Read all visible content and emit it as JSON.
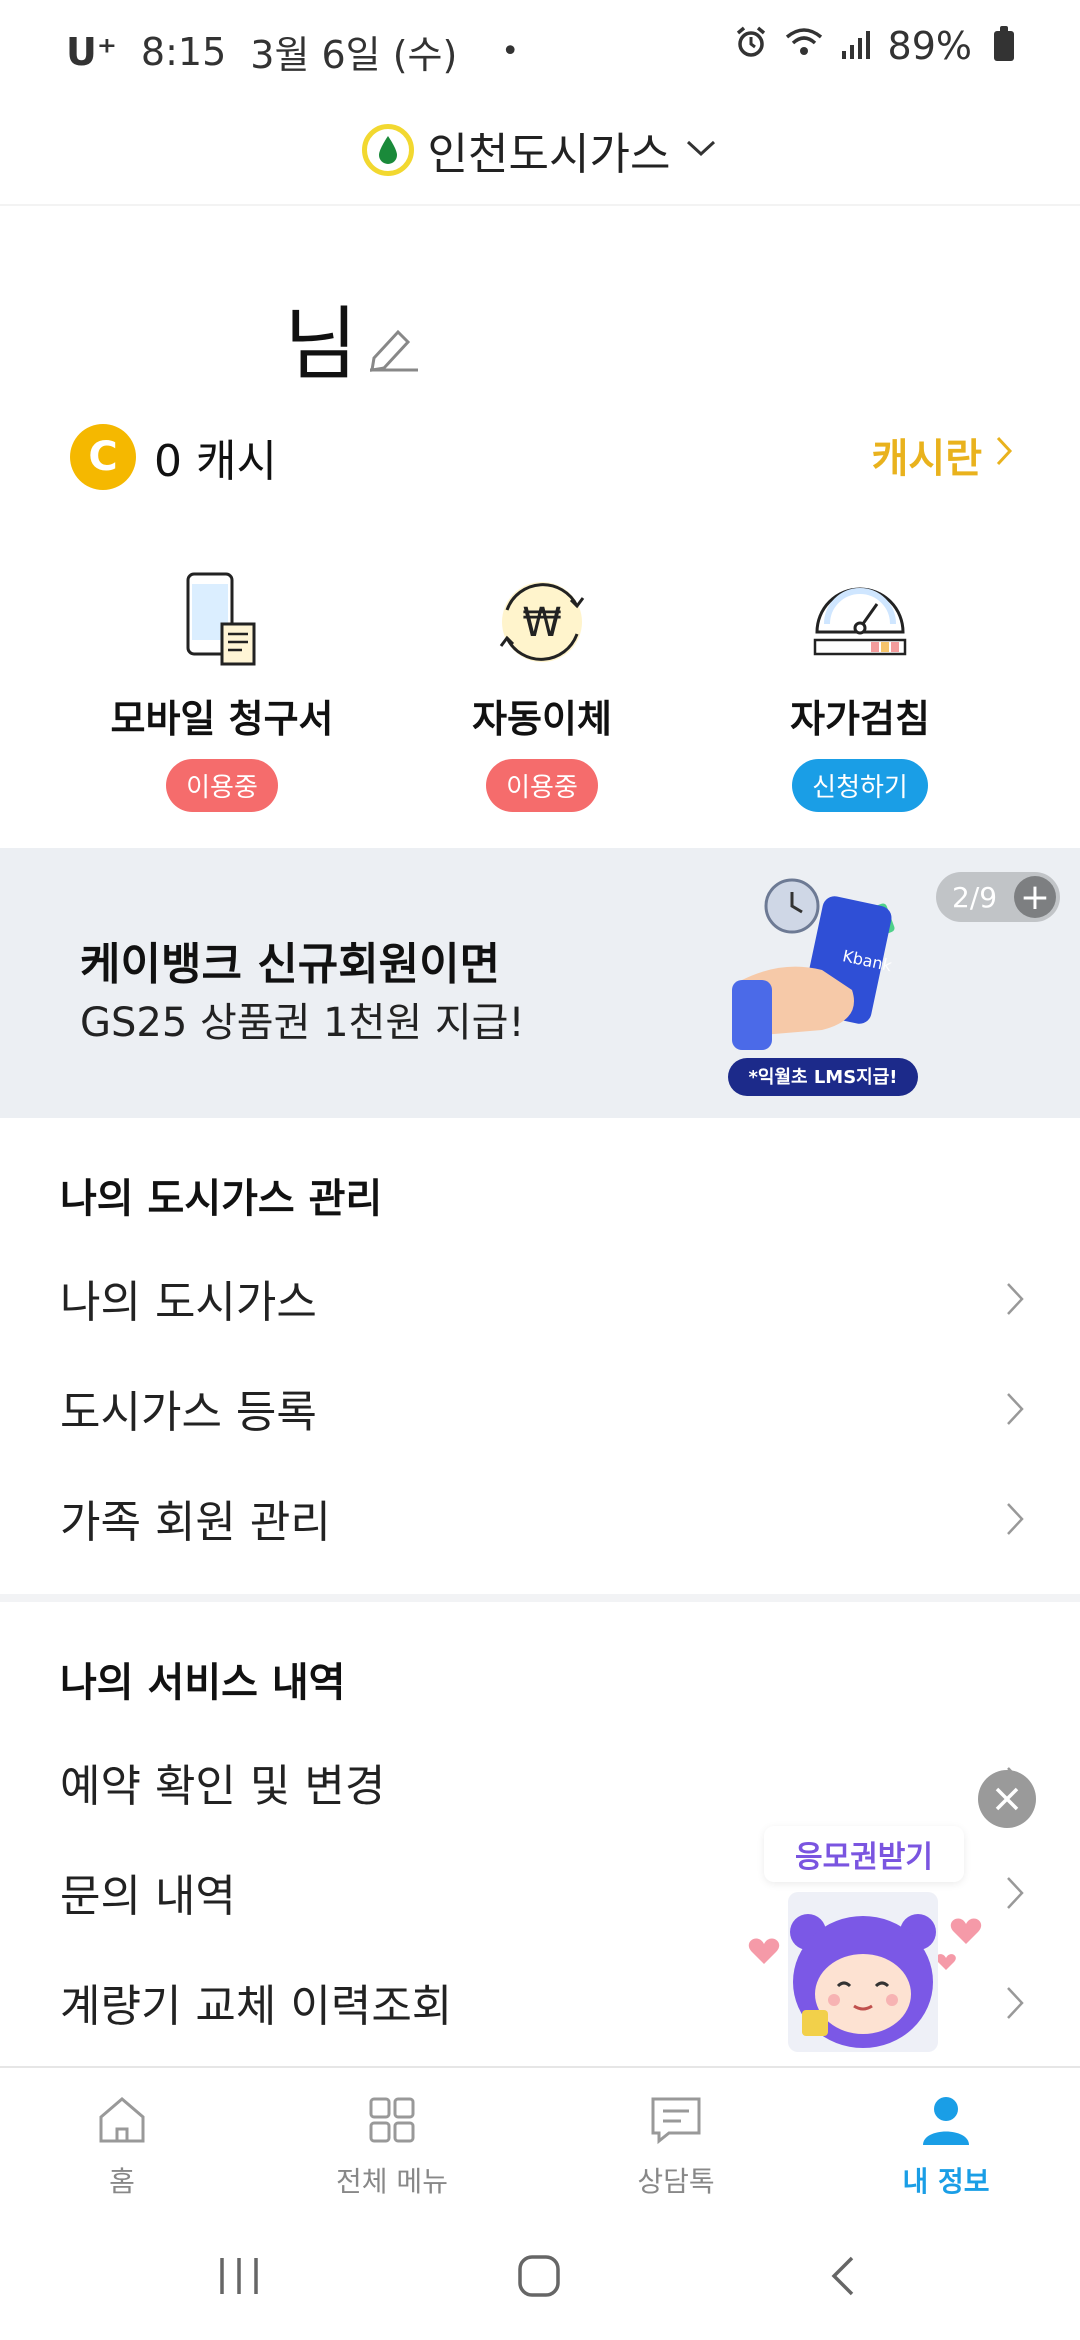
{
  "status_bar": {
    "carrier": "U⁺",
    "time": "8:15",
    "date": "3월 6일 (수)",
    "dot": "•",
    "battery": "89%"
  },
  "header": {
    "title": "인천도시가스",
    "logo_icon": "gas-drop-icon",
    "dropdown_icon": "chevron-down-icon"
  },
  "profile": {
    "name_suffix": "님",
    "edit_icon": "pencil-icon"
  },
  "cash": {
    "coin_letter": "C",
    "value": "0 캐시",
    "link_label": "캐시란"
  },
  "services": [
    {
      "label": "모바일 청구서",
      "badge": "이용중",
      "icon": "mobile-bill-icon"
    },
    {
      "label": "자동이체",
      "badge": "이용중",
      "icon": "auto-transfer-icon"
    },
    {
      "label": "자가검침",
      "badge": "신청하기",
      "icon": "gauge-meter-icon"
    }
  ],
  "banner": {
    "line1": "케이뱅크 신규회원이면",
    "line2": "GS25 상품권 1천원 지급!",
    "pager": "2/9",
    "art_caption": "*익월초 LMS지급!",
    "phone_brand": "Kbank"
  },
  "section_gas": {
    "title": "나의 도시가스 관리",
    "items": [
      "나의 도시가스",
      "도시가스 등록",
      "가족 회원 관리"
    ]
  },
  "section_service": {
    "title": "나의 서비스 내역",
    "items": [
      "예약 확인 및 변경",
      "문의 내역",
      "계량기 교체 이력조회"
    ]
  },
  "promo": {
    "title": "응모권받기"
  },
  "bottom_nav": [
    {
      "label": "홈",
      "icon": "home-icon"
    },
    {
      "label": "전체 메뉴",
      "icon": "grid-menu-icon"
    },
    {
      "label": "상담톡",
      "icon": "chat-icon"
    },
    {
      "label": "내 정보",
      "icon": "person-icon"
    }
  ],
  "colors": {
    "accent_blue": "#1a9ee6",
    "badge_red": "#f56c6c",
    "cash_gold": "#e9b21d",
    "banner_bg": "#eceff3"
  }
}
